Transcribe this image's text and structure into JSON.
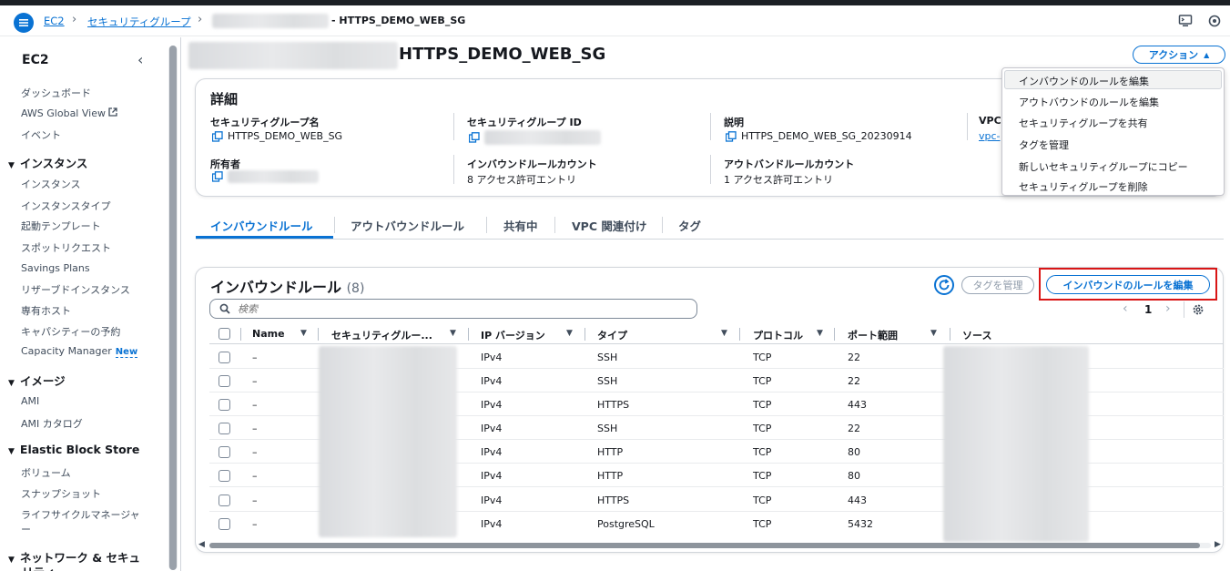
{
  "breadcrumb": {
    "items": [
      "EC2",
      "セキュリティグループ"
    ],
    "current": "- HTTPS_DEMO_WEB_SG"
  },
  "header": {
    "menu_icon": "hamburger-icon",
    "right_icons": [
      "cloudshell-icon",
      "settings-icon"
    ]
  },
  "sidebar": {
    "title": "EC2",
    "items": [
      {
        "label": "ダッシュボード"
      },
      {
        "label": "AWS Global View"
      },
      {
        "label": "イベント"
      }
    ],
    "sections": [
      {
        "label": "インスタンス",
        "items": [
          "インスタンス",
          "インスタンスタイプ",
          "起動テンプレート",
          "スポットリクエスト",
          "Savings Plans",
          "リザーブドインスタンス",
          "専有ホスト",
          "キャパシティーの予約",
          "Capacity Manager"
        ]
      },
      {
        "label": "イメージ",
        "items": [
          "AMI",
          "AMI カタログ"
        ]
      },
      {
        "label": "Elastic Block Store",
        "items": [
          "ボリューム",
          "スナップショット",
          "ライフサイクルマネージャ",
          "ー"
        ]
      },
      {
        "label": "ネットワーク & セキュ",
        "label2": "リティ"
      }
    ],
    "new_badge": "New"
  },
  "page": {
    "title": "HTTPS_DEMO_WEB_SG",
    "actions_label": "アクション"
  },
  "actions_menu": {
    "items": [
      "インバウンドのルールを編集",
      "アウトバウンドのルールを編集",
      "セキュリティグループを共有",
      "タグを管理",
      "新しいセキュリティグループにコピー",
      "セキュリティグループを削除"
    ]
  },
  "details": {
    "title": "詳細",
    "fields": {
      "sg_name_label": "セキュリティグループ名",
      "sg_name_value": "HTTPS_DEMO_WEB_SG",
      "sg_id_label": "セキュリティグループ ID",
      "description_label": "説明",
      "description_value": "HTTPS_DEMO_WEB_SG_20230914",
      "vpc_label": "VPC",
      "vpc_value": "vpc-",
      "owner_label": "所有者",
      "inbound_count_label": "インバウンドルールカウント",
      "inbound_count_value": "8 アクセス許可エントリ",
      "outbound_count_label": "アウトバンドルールカウント",
      "outbound_count_value": "1 アクセス許可エントリ"
    }
  },
  "tabs": [
    "インバウンドルール",
    "アウトバウンドルール",
    "共有中",
    "VPC 関連付け",
    "タグ"
  ],
  "rules": {
    "title": "インバウンドルール",
    "count": "(8)",
    "manage_tags": "タグを管理",
    "edit_button": "インバウンドのルールを編集",
    "search_placeholder": "検索",
    "page": "1",
    "columns": [
      "Name",
      "セキュリティグルー...",
      "IP バージョン",
      "タイプ",
      "プロトコル",
      "ポート範囲",
      "ソース"
    ],
    "rows": [
      {
        "name": "–",
        "ipver": "IPv4",
        "type": "SSH",
        "protocol": "TCP",
        "port": "22"
      },
      {
        "name": "–",
        "ipver": "IPv4",
        "type": "SSH",
        "protocol": "TCP",
        "port": "22"
      },
      {
        "name": "–",
        "ipver": "IPv4",
        "type": "HTTPS",
        "protocol": "TCP",
        "port": "443"
      },
      {
        "name": "–",
        "ipver": "IPv4",
        "type": "SSH",
        "protocol": "TCP",
        "port": "22"
      },
      {
        "name": "–",
        "ipver": "IPv4",
        "type": "HTTP",
        "protocol": "TCP",
        "port": "80"
      },
      {
        "name": "–",
        "ipver": "IPv4",
        "type": "HTTP",
        "protocol": "TCP",
        "port": "80"
      },
      {
        "name": "–",
        "ipver": "IPv4",
        "type": "HTTPS",
        "protocol": "TCP",
        "port": "443"
      },
      {
        "name": "–",
        "ipver": "IPv4",
        "type": "PostgreSQL",
        "protocol": "TCP",
        "port": "5432"
      }
    ]
  },
  "colors": {
    "accent": "#0972d3",
    "highlight": "#d91515"
  }
}
